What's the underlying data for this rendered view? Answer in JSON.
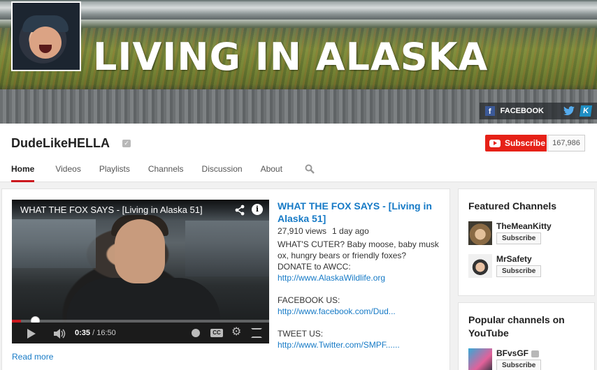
{
  "banner": {
    "title": "LIVING IN ALASKA",
    "links": {
      "facebook_label": "FACEBOOK",
      "facebook_icon": "facebook-icon",
      "twitter_icon": "twitter-icon",
      "k_icon": "k-icon"
    }
  },
  "channel": {
    "name": "DudeLikeHELLA",
    "subscribe_label": "Subscribe",
    "subscriber_count": "167,986",
    "tabs": [
      "Home",
      "Videos",
      "Playlists",
      "Channels",
      "Discussion",
      "About"
    ],
    "active_tab": "Home"
  },
  "featured_video": {
    "player_title": "WHAT THE FOX SAYS - [Living in Alaska 51]",
    "current_time": "0:35",
    "duration": "16:50",
    "progress": 0.035,
    "title": "WHAT THE FOX SAYS - [Living in Alaska 51]",
    "views": "27,910 views",
    "age": "1 day ago",
    "description": [
      {
        "text": "WHAT'S CUTER? Baby moose, baby musk ox, hungry bears or friendly foxes? DONATE to AWCC:",
        "link": "http://www.AlaskaWildlife.org"
      },
      {
        "text": "FACEBOOK US:",
        "link": "http://www.facebook.com/Dud..."
      },
      {
        "text": "TWEET US:",
        "link": "http://www.Twitter.com/SMPF......"
      }
    ],
    "read_more": "Read more"
  },
  "sidebar": {
    "featured": {
      "title": "Featured Channels",
      "channels": [
        {
          "name": "TheMeanKitty",
          "subscribe": "Subscribe"
        },
        {
          "name": "MrSafety",
          "subscribe": "Subscribe"
        }
      ]
    },
    "popular": {
      "title": "Popular channels on YouTube",
      "channels": [
        {
          "name": "BFvsGF",
          "subscribe": "Subscribe"
        }
      ]
    }
  },
  "colors": {
    "accent_red": "#e62117",
    "link_blue": "#167ac6"
  }
}
